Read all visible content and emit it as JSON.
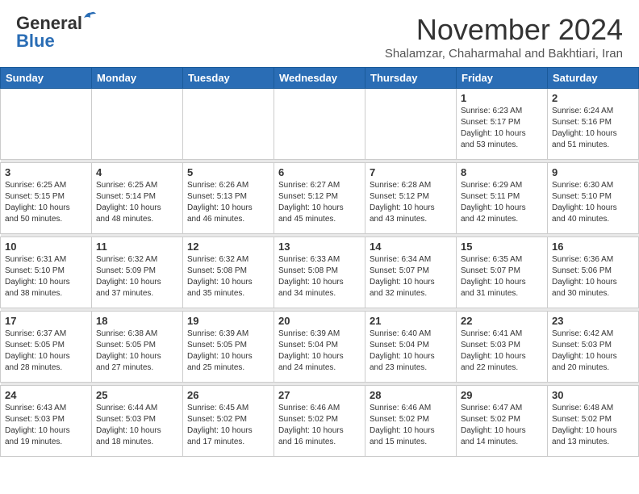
{
  "header": {
    "logo_general": "General",
    "logo_blue": "Blue",
    "month_title": "November 2024",
    "subtitle": "Shalamzar, Chaharmahal and Bakhtiari, Iran"
  },
  "weekdays": [
    "Sunday",
    "Monday",
    "Tuesday",
    "Wednesday",
    "Thursday",
    "Friday",
    "Saturday"
  ],
  "weeks": [
    [
      {
        "day": "",
        "info": ""
      },
      {
        "day": "",
        "info": ""
      },
      {
        "day": "",
        "info": ""
      },
      {
        "day": "",
        "info": ""
      },
      {
        "day": "",
        "info": ""
      },
      {
        "day": "1",
        "info": "Sunrise: 6:23 AM\nSunset: 5:17 PM\nDaylight: 10 hours\nand 53 minutes."
      },
      {
        "day": "2",
        "info": "Sunrise: 6:24 AM\nSunset: 5:16 PM\nDaylight: 10 hours\nand 51 minutes."
      }
    ],
    [
      {
        "day": "3",
        "info": "Sunrise: 6:25 AM\nSunset: 5:15 PM\nDaylight: 10 hours\nand 50 minutes."
      },
      {
        "day": "4",
        "info": "Sunrise: 6:25 AM\nSunset: 5:14 PM\nDaylight: 10 hours\nand 48 minutes."
      },
      {
        "day": "5",
        "info": "Sunrise: 6:26 AM\nSunset: 5:13 PM\nDaylight: 10 hours\nand 46 minutes."
      },
      {
        "day": "6",
        "info": "Sunrise: 6:27 AM\nSunset: 5:12 PM\nDaylight: 10 hours\nand 45 minutes."
      },
      {
        "day": "7",
        "info": "Sunrise: 6:28 AM\nSunset: 5:12 PM\nDaylight: 10 hours\nand 43 minutes."
      },
      {
        "day": "8",
        "info": "Sunrise: 6:29 AM\nSunset: 5:11 PM\nDaylight: 10 hours\nand 42 minutes."
      },
      {
        "day": "9",
        "info": "Sunrise: 6:30 AM\nSunset: 5:10 PM\nDaylight: 10 hours\nand 40 minutes."
      }
    ],
    [
      {
        "day": "10",
        "info": "Sunrise: 6:31 AM\nSunset: 5:10 PM\nDaylight: 10 hours\nand 38 minutes."
      },
      {
        "day": "11",
        "info": "Sunrise: 6:32 AM\nSunset: 5:09 PM\nDaylight: 10 hours\nand 37 minutes."
      },
      {
        "day": "12",
        "info": "Sunrise: 6:32 AM\nSunset: 5:08 PM\nDaylight: 10 hours\nand 35 minutes."
      },
      {
        "day": "13",
        "info": "Sunrise: 6:33 AM\nSunset: 5:08 PM\nDaylight: 10 hours\nand 34 minutes."
      },
      {
        "day": "14",
        "info": "Sunrise: 6:34 AM\nSunset: 5:07 PM\nDaylight: 10 hours\nand 32 minutes."
      },
      {
        "day": "15",
        "info": "Sunrise: 6:35 AM\nSunset: 5:07 PM\nDaylight: 10 hours\nand 31 minutes."
      },
      {
        "day": "16",
        "info": "Sunrise: 6:36 AM\nSunset: 5:06 PM\nDaylight: 10 hours\nand 30 minutes."
      }
    ],
    [
      {
        "day": "17",
        "info": "Sunrise: 6:37 AM\nSunset: 5:05 PM\nDaylight: 10 hours\nand 28 minutes."
      },
      {
        "day": "18",
        "info": "Sunrise: 6:38 AM\nSunset: 5:05 PM\nDaylight: 10 hours\nand 27 minutes."
      },
      {
        "day": "19",
        "info": "Sunrise: 6:39 AM\nSunset: 5:05 PM\nDaylight: 10 hours\nand 25 minutes."
      },
      {
        "day": "20",
        "info": "Sunrise: 6:39 AM\nSunset: 5:04 PM\nDaylight: 10 hours\nand 24 minutes."
      },
      {
        "day": "21",
        "info": "Sunrise: 6:40 AM\nSunset: 5:04 PM\nDaylight: 10 hours\nand 23 minutes."
      },
      {
        "day": "22",
        "info": "Sunrise: 6:41 AM\nSunset: 5:03 PM\nDaylight: 10 hours\nand 22 minutes."
      },
      {
        "day": "23",
        "info": "Sunrise: 6:42 AM\nSunset: 5:03 PM\nDaylight: 10 hours\nand 20 minutes."
      }
    ],
    [
      {
        "day": "24",
        "info": "Sunrise: 6:43 AM\nSunset: 5:03 PM\nDaylight: 10 hours\nand 19 minutes."
      },
      {
        "day": "25",
        "info": "Sunrise: 6:44 AM\nSunset: 5:03 PM\nDaylight: 10 hours\nand 18 minutes."
      },
      {
        "day": "26",
        "info": "Sunrise: 6:45 AM\nSunset: 5:02 PM\nDaylight: 10 hours\nand 17 minutes."
      },
      {
        "day": "27",
        "info": "Sunrise: 6:46 AM\nSunset: 5:02 PM\nDaylight: 10 hours\nand 16 minutes."
      },
      {
        "day": "28",
        "info": "Sunrise: 6:46 AM\nSunset: 5:02 PM\nDaylight: 10 hours\nand 15 minutes."
      },
      {
        "day": "29",
        "info": "Sunrise: 6:47 AM\nSunset: 5:02 PM\nDaylight: 10 hours\nand 14 minutes."
      },
      {
        "day": "30",
        "info": "Sunrise: 6:48 AM\nSunset: 5:02 PM\nDaylight: 10 hours\nand 13 minutes."
      }
    ]
  ]
}
